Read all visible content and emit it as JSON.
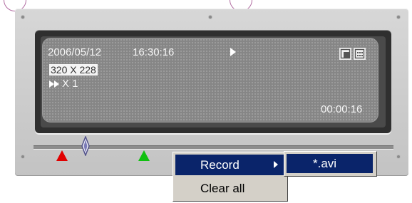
{
  "screen": {
    "date": "2006/05/12",
    "time": "16:30:16",
    "resolution": "320 X 228",
    "speed": "X 1",
    "elapsed": "00:00:16"
  },
  "icons": {
    "play": "play-icon",
    "fast_forward": "fast-forward-icon",
    "resize": "resize-icon",
    "grid": "grid-icon"
  },
  "markers": {
    "start_color": "#e00000",
    "end_color": "#10c010"
  },
  "context_menu": {
    "items": [
      {
        "label": "Record",
        "has_submenu": true,
        "highlighted": true
      },
      {
        "label": "Clear all",
        "has_submenu": false,
        "highlighted": false
      }
    ],
    "submenu": {
      "items": [
        {
          "label": "*.avi"
        }
      ]
    }
  },
  "colors": {
    "menu_highlight": "#0a246a",
    "menu_background": "#d4d0c8"
  }
}
